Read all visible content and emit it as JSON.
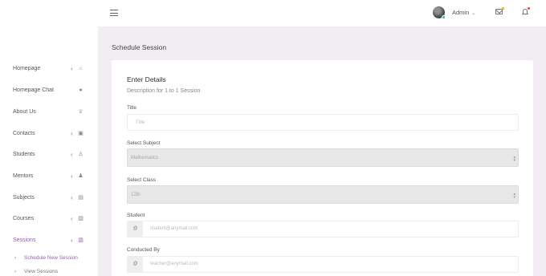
{
  "header": {
    "user_name": "Admin",
    "icons": [
      "menu-icon",
      "avatar",
      "chevron-down-icon",
      "mail-icon",
      "bell-icon"
    ]
  },
  "sidebar": {
    "items": [
      {
        "label": "Homepage",
        "icon": "home-icon"
      },
      {
        "label": "Homepage Chat",
        "icon": "chat-icon"
      },
      {
        "label": "About Us",
        "icon": "trophy-icon"
      },
      {
        "label": "Contacts",
        "icon": "contacts-icon"
      },
      {
        "label": "Students",
        "icon": "student-icon"
      },
      {
        "label": "Mentors",
        "icon": "user-icon"
      },
      {
        "label": "Subjects",
        "icon": "book-icon"
      },
      {
        "label": "Courses",
        "icon": "courses-icon"
      },
      {
        "label": "Sessions",
        "icon": "sessions-icon"
      }
    ],
    "sub_items": [
      {
        "label": "Schedule New Session"
      },
      {
        "label": "View Sessions"
      }
    ],
    "active_item": "Sessions",
    "active_sub_item": "Schedule New Session",
    "accent_color": "#9b59b6"
  },
  "main": {
    "page_title": "Schedule Session",
    "card_title": "Enter Details",
    "card_desc": "Description for 1 to 1 Session",
    "fields": {
      "title": {
        "label": "Title",
        "placeholder": "Title"
      },
      "subject": {
        "label": "Select Subject",
        "value": "Mathematics"
      },
      "class": {
        "label": "Select Class",
        "value": "12th"
      },
      "student": {
        "label": "Student",
        "addon": "@",
        "placeholder": "student@anymail.com"
      },
      "conducted_by": {
        "label": "Conducted By",
        "addon": "@",
        "placeholder": "teacher@anymail.com"
      }
    }
  }
}
